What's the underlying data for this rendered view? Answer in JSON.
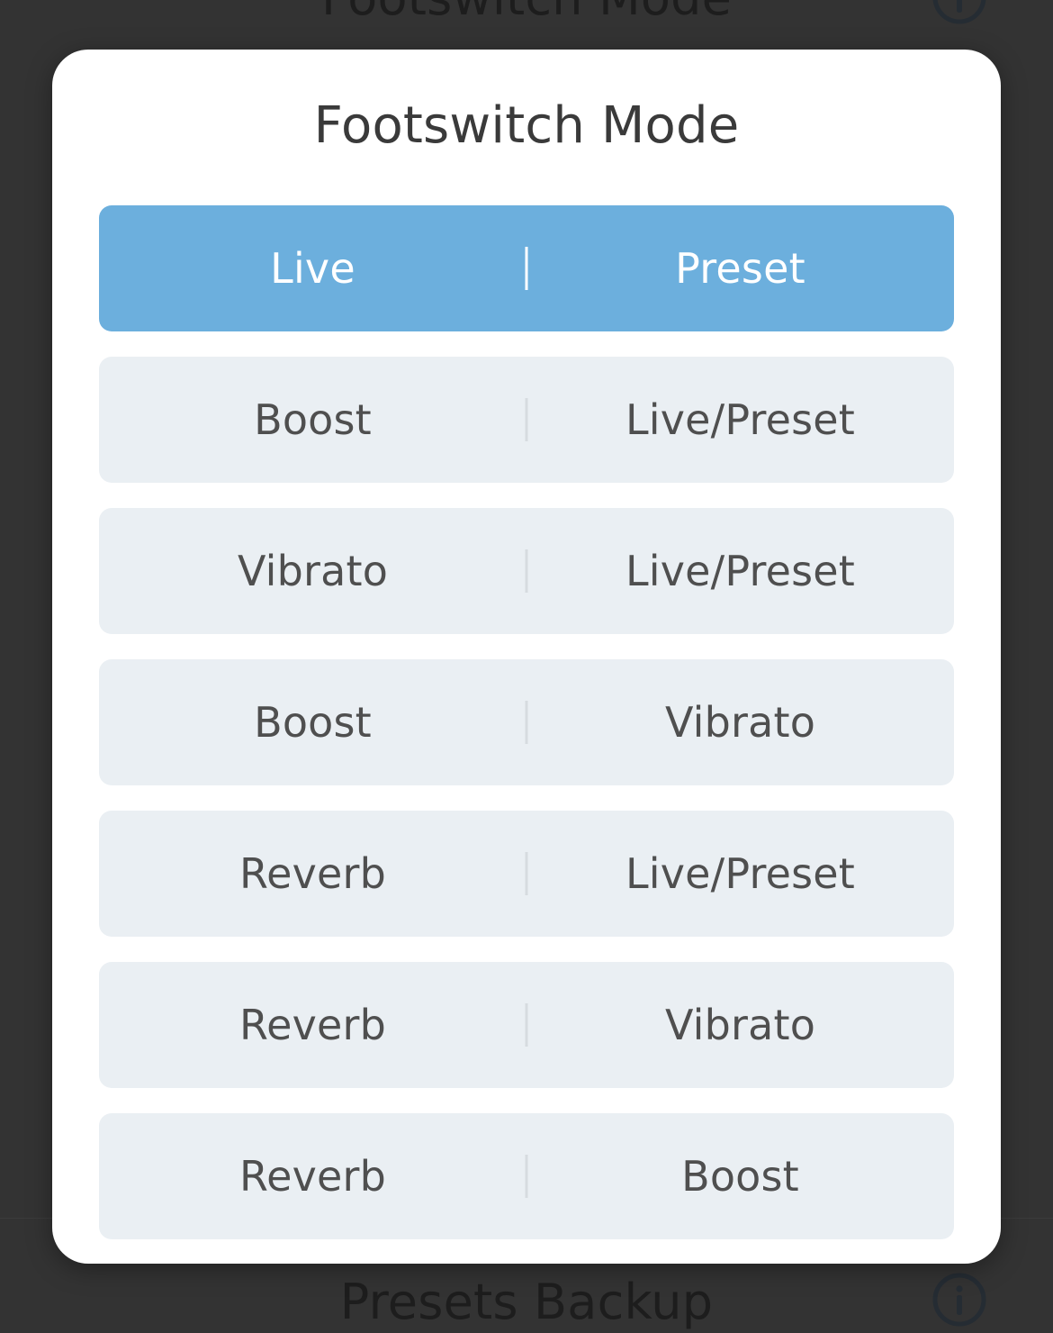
{
  "background": {
    "top_screen_title": "Footswitch Mode",
    "bottom_screen_title": "Presets Backup",
    "info_icon_top": "info-icon",
    "info_icon_bottom": "info-icon",
    "backdrop_color": "#333333",
    "text_color": "#1d1d1d"
  },
  "dialog": {
    "title": "Footswitch Mode",
    "selected_index": 0,
    "selected_color": "#6cafdd",
    "unselected_color": "#eaeff3",
    "selected_text_color": "#ffffff",
    "unselected_text_color": "#4f4f4f",
    "divider_glyph": "|",
    "options": [
      {
        "left": "Live",
        "right": "Preset",
        "selected": true
      },
      {
        "left": "Boost",
        "right": "Live/Preset",
        "selected": false
      },
      {
        "left": "Vibrato",
        "right": "Live/Preset",
        "selected": false
      },
      {
        "left": "Boost",
        "right": "Vibrato",
        "selected": false
      },
      {
        "left": "Reverb",
        "right": "Live/Preset",
        "selected": false
      },
      {
        "left": "Reverb",
        "right": "Vibrato",
        "selected": false
      },
      {
        "left": "Reverb",
        "right": "Boost",
        "selected": false
      }
    ]
  }
}
